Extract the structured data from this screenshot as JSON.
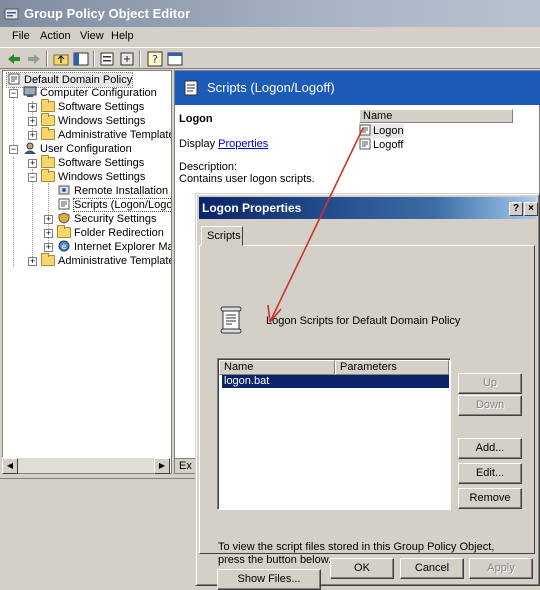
{
  "window": {
    "title": "Group Policy Object Editor"
  },
  "menu": {
    "file": "File",
    "action": "Action",
    "view": "View",
    "help": "Help"
  },
  "tree": {
    "root": "Default Domain Policy",
    "computer_config": "Computer Configuration",
    "cc_software": "Software Settings",
    "cc_windows": "Windows Settings",
    "cc_admin": "Administrative Templates",
    "user_config": "User Configuration",
    "uc_software": "Software Settings",
    "uc_windows": "Windows Settings",
    "remote_install": "Remote Installation Ser",
    "scripts": "Scripts (Logon/Logoff)",
    "security": "Security Settings",
    "folder_redirection": "Folder Redirection",
    "ie_maint": "Internet Explorer Maint",
    "uc_admin": "Administrative Templates"
  },
  "right_pane": {
    "header": "Scripts (Logon/Logoff)",
    "heading": "Logon",
    "display_prefix": "Display ",
    "properties_link": "Properties",
    "description_label": "Description:",
    "description_text": "Contains user logon scripts.",
    "name_col": "Name",
    "items": [
      "Logon",
      "Logoff"
    ],
    "bottom_tab": "Ex"
  },
  "dialog": {
    "title": "Logon Properties",
    "help_btn": "?",
    "close_btn": "×",
    "tab": "Scripts",
    "heading": "Logon Scripts for Default Domain Policy",
    "col_name": "Name",
    "col_params": "Parameters",
    "row_name": "logon.bat",
    "btn_up": "Up",
    "btn_down": "Down",
    "btn_add": "Add...",
    "btn_edit": "Edit...",
    "btn_remove": "Remove",
    "info": "To view the script files stored in this Group Policy Object, press the button below.",
    "btn_show_files": "Show Files...",
    "btn_ok": "OK",
    "btn_cancel": "Cancel",
    "btn_apply": "Apply"
  },
  "colors": {
    "annotation_arrow": "#d0322d",
    "selection": "#0a246a",
    "header_blue": "#1c5bb8"
  }
}
